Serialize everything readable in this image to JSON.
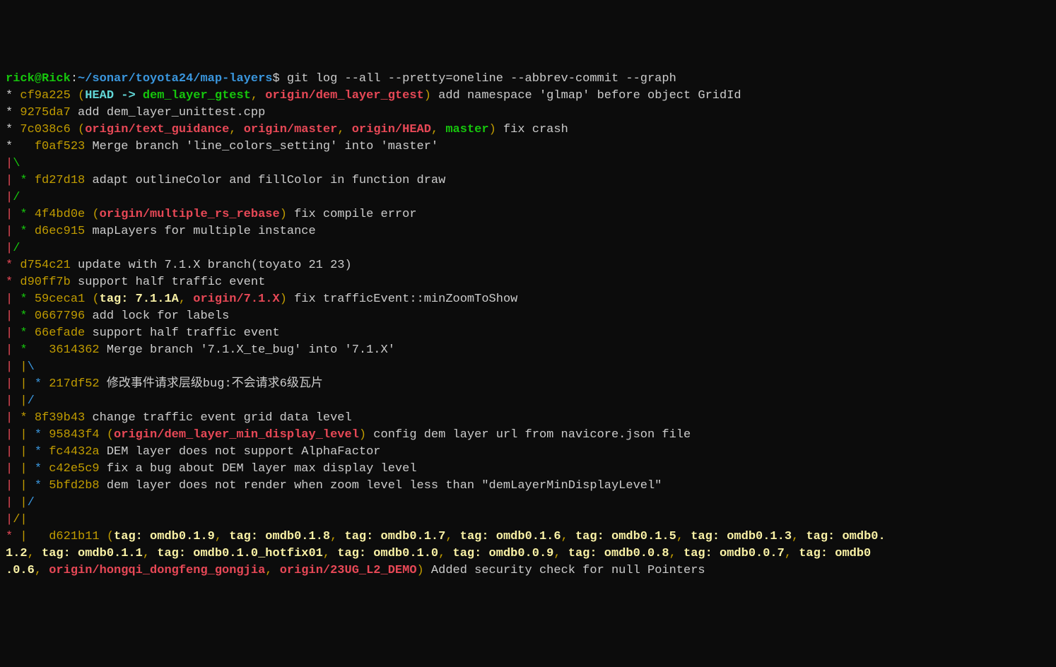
{
  "prompt": {
    "userhost": "rick@Rick",
    "colon": ":",
    "path": "~/sonar/toyota24/map-layers",
    "dollar": "$ ",
    "command": "git log --all --pretty=oneline --abbrev-commit --graph"
  },
  "lines": [
    {
      "segments": [
        {
          "t": "* ",
          "c": "white"
        },
        {
          "t": "cf9a225 ",
          "c": "yellow"
        },
        {
          "t": "(",
          "c": "yellow"
        },
        {
          "t": "HEAD -> ",
          "c": "bold-cyan"
        },
        {
          "t": "dem_layer_gtest",
          "c": "bold-green"
        },
        {
          "t": ", ",
          "c": "yellow"
        },
        {
          "t": "origin/dem_layer_gtest",
          "c": "bold-red"
        },
        {
          "t": ")",
          "c": "yellow"
        },
        {
          "t": " add namespace 'glmap' before object GridId",
          "c": "white"
        }
      ]
    },
    {
      "segments": [
        {
          "t": "* ",
          "c": "white"
        },
        {
          "t": "9275da7 ",
          "c": "yellow"
        },
        {
          "t": "add dem_layer_unittest.cpp",
          "c": "white"
        }
      ]
    },
    {
      "segments": [
        {
          "t": "* ",
          "c": "white"
        },
        {
          "t": "7c038c6 ",
          "c": "yellow"
        },
        {
          "t": "(",
          "c": "yellow"
        },
        {
          "t": "origin/text_guidance",
          "c": "bold-red"
        },
        {
          "t": ", ",
          "c": "yellow"
        },
        {
          "t": "origin/master",
          "c": "bold-red"
        },
        {
          "t": ", ",
          "c": "yellow"
        },
        {
          "t": "origin/HEAD",
          "c": "bold-red"
        },
        {
          "t": ", ",
          "c": "yellow"
        },
        {
          "t": "master",
          "c": "bold-green"
        },
        {
          "t": ")",
          "c": "yellow"
        },
        {
          "t": " fix crash",
          "c": "white"
        }
      ]
    },
    {
      "segments": [
        {
          "t": "*   ",
          "c": "white"
        },
        {
          "t": "f0af523 ",
          "c": "yellow"
        },
        {
          "t": "Merge branch 'line_colors_setting' into 'master'",
          "c": "white"
        }
      ]
    },
    {
      "segments": [
        {
          "t": "|",
          "c": "red"
        },
        {
          "t": "\\",
          "c": "green"
        },
        {
          "t": "  ",
          "c": "white"
        }
      ]
    },
    {
      "segments": [
        {
          "t": "| ",
          "c": "red"
        },
        {
          "t": "* ",
          "c": "green"
        },
        {
          "t": "fd27d18 ",
          "c": "yellow"
        },
        {
          "t": "adapt outlineColor and fillColor in function draw",
          "c": "white"
        }
      ]
    },
    {
      "segments": [
        {
          "t": "|",
          "c": "red"
        },
        {
          "t": "/",
          "c": "green"
        },
        {
          "t": "  ",
          "c": "white"
        }
      ]
    },
    {
      "segments": [
        {
          "t": "| ",
          "c": "red"
        },
        {
          "t": "* ",
          "c": "green"
        },
        {
          "t": "4f4bd0e ",
          "c": "yellow"
        },
        {
          "t": "(",
          "c": "yellow"
        },
        {
          "t": "origin/multiple_rs_rebase",
          "c": "bold-red"
        },
        {
          "t": ")",
          "c": "yellow"
        },
        {
          "t": " fix compile error",
          "c": "white"
        }
      ]
    },
    {
      "segments": [
        {
          "t": "| ",
          "c": "red"
        },
        {
          "t": "* ",
          "c": "green"
        },
        {
          "t": "d6ec915 ",
          "c": "yellow"
        },
        {
          "t": "mapLayers for multiple instance",
          "c": "white"
        }
      ]
    },
    {
      "segments": [
        {
          "t": "|",
          "c": "red"
        },
        {
          "t": "/",
          "c": "green"
        },
        {
          "t": "  ",
          "c": "white"
        }
      ]
    },
    {
      "segments": [
        {
          "t": "* ",
          "c": "red"
        },
        {
          "t": "d754c21 ",
          "c": "yellow"
        },
        {
          "t": "update with 7.1.X branch(toyato 21 23)",
          "c": "white"
        }
      ]
    },
    {
      "segments": [
        {
          "t": "* ",
          "c": "red"
        },
        {
          "t": "d90ff7b ",
          "c": "yellow"
        },
        {
          "t": "support half traffic event",
          "c": "white"
        }
      ]
    },
    {
      "segments": [
        {
          "t": "| ",
          "c": "red"
        },
        {
          "t": "* ",
          "c": "green"
        },
        {
          "t": "59ceca1 ",
          "c": "yellow"
        },
        {
          "t": "(",
          "c": "yellow"
        },
        {
          "t": "tag: 7.1.1A",
          "c": "bold-yellow"
        },
        {
          "t": ", ",
          "c": "yellow"
        },
        {
          "t": "origin/7.1.X",
          "c": "bold-red"
        },
        {
          "t": ")",
          "c": "yellow"
        },
        {
          "t": " fix trafficEvent::minZoomToShow",
          "c": "white"
        }
      ]
    },
    {
      "segments": [
        {
          "t": "| ",
          "c": "red"
        },
        {
          "t": "* ",
          "c": "green"
        },
        {
          "t": "0667796 ",
          "c": "yellow"
        },
        {
          "t": "add lock for labels",
          "c": "white"
        }
      ]
    },
    {
      "segments": [
        {
          "t": "| ",
          "c": "red"
        },
        {
          "t": "* ",
          "c": "green"
        },
        {
          "t": "66efade ",
          "c": "yellow"
        },
        {
          "t": "support half traffic event",
          "c": "white"
        }
      ]
    },
    {
      "segments": [
        {
          "t": "| ",
          "c": "red"
        },
        {
          "t": "*   ",
          "c": "green"
        },
        {
          "t": "3614362 ",
          "c": "yellow"
        },
        {
          "t": "Merge branch '7.1.X_te_bug' into '7.1.X'",
          "c": "white"
        }
      ]
    },
    {
      "segments": [
        {
          "t": "| ",
          "c": "red"
        },
        {
          "t": "|",
          "c": "yellow"
        },
        {
          "t": "\\",
          "c": "cyan"
        },
        {
          "t": "  ",
          "c": "white"
        }
      ]
    },
    {
      "segments": [
        {
          "t": "| ",
          "c": "red"
        },
        {
          "t": "| ",
          "c": "yellow"
        },
        {
          "t": "* ",
          "c": "cyan"
        },
        {
          "t": "217df52 ",
          "c": "yellow"
        },
        {
          "t": "修改事件请求层级bug:不会请求6级瓦片",
          "c": "white"
        }
      ]
    },
    {
      "segments": [
        {
          "t": "| ",
          "c": "red"
        },
        {
          "t": "|",
          "c": "yellow"
        },
        {
          "t": "/",
          "c": "cyan"
        },
        {
          "t": "  ",
          "c": "white"
        }
      ]
    },
    {
      "segments": [
        {
          "t": "| ",
          "c": "red"
        },
        {
          "t": "* ",
          "c": "yellow"
        },
        {
          "t": "8f39b43 ",
          "c": "yellow"
        },
        {
          "t": "change traffic event grid data level",
          "c": "white"
        }
      ]
    },
    {
      "segments": [
        {
          "t": "| ",
          "c": "red"
        },
        {
          "t": "| ",
          "c": "yellow"
        },
        {
          "t": "* ",
          "c": "cyan"
        },
        {
          "t": "95843f4 ",
          "c": "yellow"
        },
        {
          "t": "(",
          "c": "yellow"
        },
        {
          "t": "origin/dem_layer_min_display_level",
          "c": "bold-red"
        },
        {
          "t": ")",
          "c": "yellow"
        },
        {
          "t": " config dem layer url from navicore.json file",
          "c": "white"
        }
      ]
    },
    {
      "segments": [
        {
          "t": "| ",
          "c": "red"
        },
        {
          "t": "| ",
          "c": "yellow"
        },
        {
          "t": "* ",
          "c": "cyan"
        },
        {
          "t": "fc4432a ",
          "c": "yellow"
        },
        {
          "t": "DEM layer does not support AlphaFactor",
          "c": "white"
        }
      ]
    },
    {
      "segments": [
        {
          "t": "| ",
          "c": "red"
        },
        {
          "t": "| ",
          "c": "yellow"
        },
        {
          "t": "* ",
          "c": "cyan"
        },
        {
          "t": "c42e5c9 ",
          "c": "yellow"
        },
        {
          "t": "fix a bug about DEM layer max display level",
          "c": "white"
        }
      ]
    },
    {
      "segments": [
        {
          "t": "| ",
          "c": "red"
        },
        {
          "t": "| ",
          "c": "yellow"
        },
        {
          "t": "* ",
          "c": "cyan"
        },
        {
          "t": "5bfd2b8 ",
          "c": "yellow"
        },
        {
          "t": "dem layer does not render when zoom level less than \"demLayerMinDisplayLevel\"",
          "c": "white"
        }
      ]
    },
    {
      "segments": [
        {
          "t": "| ",
          "c": "red"
        },
        {
          "t": "|",
          "c": "yellow"
        },
        {
          "t": "/",
          "c": "cyan"
        },
        {
          "t": "  ",
          "c": "white"
        }
      ]
    },
    {
      "segments": [
        {
          "t": "|",
          "c": "red"
        },
        {
          "t": "/",
          "c": "yellow"
        },
        {
          "t": "|",
          "c": "yellow"
        },
        {
          "t": "   ",
          "c": "white"
        }
      ]
    },
    {
      "segments": [
        {
          "t": "* ",
          "c": "red"
        },
        {
          "t": "| ",
          "c": "yellow"
        },
        {
          "t": "  ",
          "c": "white"
        },
        {
          "t": "d621b11 ",
          "c": "yellow"
        },
        {
          "t": "(",
          "c": "yellow"
        },
        {
          "t": "tag: omdb0.1.9",
          "c": "bold-yellow"
        },
        {
          "t": ", ",
          "c": "yellow"
        },
        {
          "t": "tag: omdb0.1.8",
          "c": "bold-yellow"
        },
        {
          "t": ", ",
          "c": "yellow"
        },
        {
          "t": "tag: omdb0.1.7",
          "c": "bold-yellow"
        },
        {
          "t": ", ",
          "c": "yellow"
        },
        {
          "t": "tag: omdb0.1.6",
          "c": "bold-yellow"
        },
        {
          "t": ", ",
          "c": "yellow"
        },
        {
          "t": "tag: omdb0.1.5",
          "c": "bold-yellow"
        },
        {
          "t": ", ",
          "c": "yellow"
        },
        {
          "t": "tag: omdb0.1.3",
          "c": "bold-yellow"
        },
        {
          "t": ", ",
          "c": "yellow"
        },
        {
          "t": "tag: omdb0.",
          "c": "bold-yellow"
        }
      ]
    },
    {
      "segments": [
        {
          "t": "1.2",
          "c": "bold-yellow"
        },
        {
          "t": ", ",
          "c": "yellow"
        },
        {
          "t": "tag: omdb0.1.1",
          "c": "bold-yellow"
        },
        {
          "t": ", ",
          "c": "yellow"
        },
        {
          "t": "tag: omdb0.1.0_hotfix01",
          "c": "bold-yellow"
        },
        {
          "t": ", ",
          "c": "yellow"
        },
        {
          "t": "tag: omdb0.1.0",
          "c": "bold-yellow"
        },
        {
          "t": ", ",
          "c": "yellow"
        },
        {
          "t": "tag: omdb0.0.9",
          "c": "bold-yellow"
        },
        {
          "t": ", ",
          "c": "yellow"
        },
        {
          "t": "tag: omdb0.0.8",
          "c": "bold-yellow"
        },
        {
          "t": ", ",
          "c": "yellow"
        },
        {
          "t": "tag: omdb0.0.7",
          "c": "bold-yellow"
        },
        {
          "t": ", ",
          "c": "yellow"
        },
        {
          "t": "tag: omdb0",
          "c": "bold-yellow"
        }
      ]
    },
    {
      "segments": [
        {
          "t": ".0.6",
          "c": "bold-yellow"
        },
        {
          "t": ", ",
          "c": "yellow"
        },
        {
          "t": "origin/hongqi_dongfeng_gongjia",
          "c": "bold-red"
        },
        {
          "t": ", ",
          "c": "yellow"
        },
        {
          "t": "origin/23UG_L2_DEMO",
          "c": "bold-red"
        },
        {
          "t": ")",
          "c": "yellow"
        },
        {
          "t": " Added security check for null Pointers",
          "c": "white"
        }
      ]
    }
  ]
}
